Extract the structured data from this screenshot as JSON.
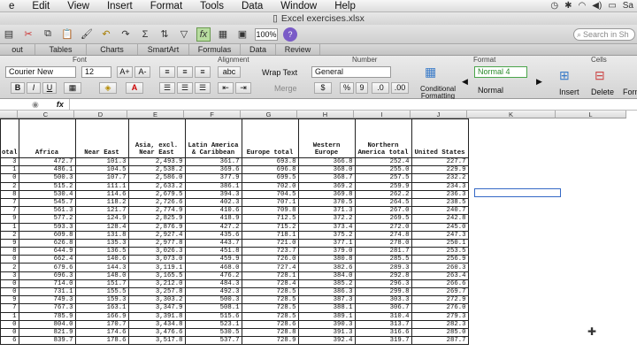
{
  "menubar": {
    "items": [
      "e",
      "Edit",
      "View",
      "Insert",
      "Format",
      "Tools",
      "Data",
      "Window",
      "Help"
    ],
    "user": "Sa"
  },
  "window": {
    "title": "Excel exercises.xlsx"
  },
  "toolbar": {
    "zoom": "100%",
    "search_placeholder": "Search in Sh"
  },
  "ribbon": {
    "tabs": [
      "out",
      "Tables",
      "Charts",
      "SmartArt",
      "Formulas",
      "Data",
      "Review"
    ],
    "groups": {
      "font": "Font",
      "alignment": "Alignment",
      "number": "Number",
      "format": "Format",
      "cells": "Cells"
    },
    "font_name": "Courier New",
    "font_size": "12",
    "bold": "B",
    "italic": "I",
    "underline": "U",
    "abc": "abc",
    "wrap_text": "Wrap Text",
    "merge": "Merge",
    "number_format": "General",
    "percent": "%",
    "comma": "9",
    "style_normal4": "Normal 4",
    "style_normal": "Normal",
    "conditional_formatting": "Conditional Formatting",
    "insert": "Insert",
    "delete": "Delete",
    "format_btn": "Form"
  },
  "formula_bar": {
    "fx": "fx",
    "value": ""
  },
  "columns": [
    "",
    "C",
    "D",
    "E",
    "F",
    "G",
    "H",
    "I",
    "J",
    "K",
    "L"
  ],
  "headers": [
    "otal",
    "Africa",
    "Near East",
    "Asia, excl. Near East",
    "Latin America & Caribbean",
    "Europe total",
    "Western Europe",
    "Northern America total",
    "United States"
  ],
  "rows": [
    [
      "3",
      "472.7",
      "101.3",
      "2,493.9",
      "361.7",
      "693.8",
      "366.8",
      "252.4",
      "227.7"
    ],
    [
      "1",
      "486.1",
      "104.5",
      "2,538.2",
      "369.6",
      "696.8",
      "368.0",
      "255.0",
      "229.9"
    ],
    [
      "0",
      "500.3",
      "107.7",
      "2,586.0",
      "377.9",
      "699.5",
      "368.7",
      "257.5",
      "232.2"
    ],
    [
      "2",
      "515.2",
      "111.1",
      "2,633.2",
      "386.1",
      "702.0",
      "369.2",
      "259.9",
      "234.3"
    ],
    [
      "8",
      "530.4",
      "114.6",
      "2,679.5",
      "394.3",
      "704.5",
      "369.8",
      "262.2",
      "236.3"
    ],
    [
      "7",
      "545.7",
      "118.2",
      "2,726.6",
      "402.3",
      "707.1",
      "370.5",
      "264.5",
      "238.5"
    ],
    [
      "7",
      "561.3",
      "121.7",
      "2,774.9",
      "410.6",
      "709.8",
      "371.3",
      "267.0",
      "240.7"
    ],
    [
      "9",
      "577.2",
      "124.9",
      "2,825.9",
      "418.9",
      "712.5",
      "372.2",
      "269.5",
      "242.8"
    ],
    [
      "1",
      "593.3",
      "128.4",
      "2,876.9",
      "427.2",
      "715.2",
      "373.4",
      "272.0",
      "245.0"
    ],
    [
      "2",
      "609.8",
      "131.8",
      "2,927.4",
      "435.6",
      "718.1",
      "375.2",
      "274.8",
      "247.3"
    ],
    [
      "9",
      "626.8",
      "135.3",
      "2,977.8",
      "443.7",
      "721.0",
      "377.1",
      "278.0",
      "250.1"
    ],
    [
      "8",
      "644.9",
      "136.5",
      "3,026.3",
      "451.8",
      "723.7",
      "379.0",
      "281.7",
      "253.5"
    ],
    [
      "0",
      "662.4",
      "140.6",
      "3,073.0",
      "459.9",
      "726.0",
      "380.8",
      "285.5",
      "256.9"
    ],
    [
      "2",
      "679.6",
      "144.3",
      "3,119.1",
      "468.0",
      "727.4",
      "382.6",
      "289.3",
      "260.3"
    ],
    [
      "3",
      "696.3",
      "148.0",
      "3,165.5",
      "476.2",
      "728.1",
      "384.0",
      "292.8",
      "263.4"
    ],
    [
      "0",
      "714.0",
      "151.7",
      "3,212.0",
      "484.3",
      "728.4",
      "385.2",
      "296.3",
      "266.6"
    ],
    [
      "0",
      "731.1",
      "155.5",
      "3,257.8",
      "492.3",
      "728.5",
      "386.3",
      "299.8",
      "269.7"
    ],
    [
      "9",
      "749.3",
      "159.3",
      "3,303.2",
      "500.3",
      "728.5",
      "387.3",
      "303.3",
      "272.9"
    ],
    [
      "7",
      "767.3",
      "163.1",
      "3,347.9",
      "508.1",
      "728.5",
      "388.1",
      "306.7",
      "276.0"
    ],
    [
      "1",
      "785.9",
      "166.9",
      "3,391.8",
      "515.6",
      "728.5",
      "389.1",
      "310.4",
      "279.3"
    ],
    [
      "0",
      "804.0",
      "170.7",
      "3,434.8",
      "523.1",
      "728.6",
      "390.3",
      "313.7",
      "282.3"
    ],
    [
      "0",
      "821.9",
      "174.6",
      "3,476.6",
      "530.5",
      "728.8",
      "391.3",
      "316.6",
      "285.0"
    ],
    [
      "6",
      "839.7",
      "178.6",
      "3,517.8",
      "537.7",
      "728.9",
      "392.4",
      "319.7",
      "287.7"
    ]
  ]
}
